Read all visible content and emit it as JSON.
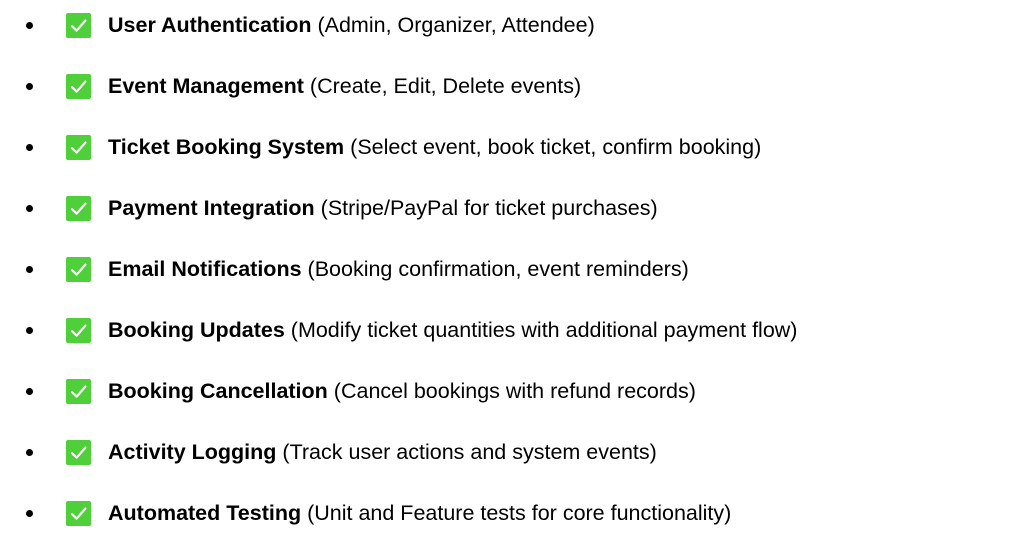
{
  "accent_check_color": "#4fcf3a",
  "features": [
    {
      "icon": "check-mark-icon",
      "name": "User Authentication",
      "detail": "(Admin, Organizer, Attendee)"
    },
    {
      "icon": "check-mark-icon",
      "name": "Event Management",
      "detail": "(Create, Edit, Delete events)"
    },
    {
      "icon": "check-mark-icon",
      "name": "Ticket Booking System",
      "detail": "(Select event, book ticket, confirm booking)"
    },
    {
      "icon": "check-mark-icon",
      "name": "Payment Integration",
      "detail": "(Stripe/PayPal for ticket purchases)"
    },
    {
      "icon": "check-mark-icon",
      "name": "Email Notifications",
      "detail": "(Booking confirmation, event reminders)"
    },
    {
      "icon": "check-mark-icon",
      "name": "Booking Updates",
      "detail": "(Modify ticket quantities with additional payment flow)"
    },
    {
      "icon": "check-mark-icon",
      "name": "Booking Cancellation",
      "detail": "(Cancel bookings with refund records)"
    },
    {
      "icon": "check-mark-icon",
      "name": "Activity Logging",
      "detail": "(Track user actions and system events)"
    },
    {
      "icon": "check-mark-icon",
      "name": "Automated Testing",
      "detail": "(Unit and Feature tests for core functionality)"
    }
  ]
}
